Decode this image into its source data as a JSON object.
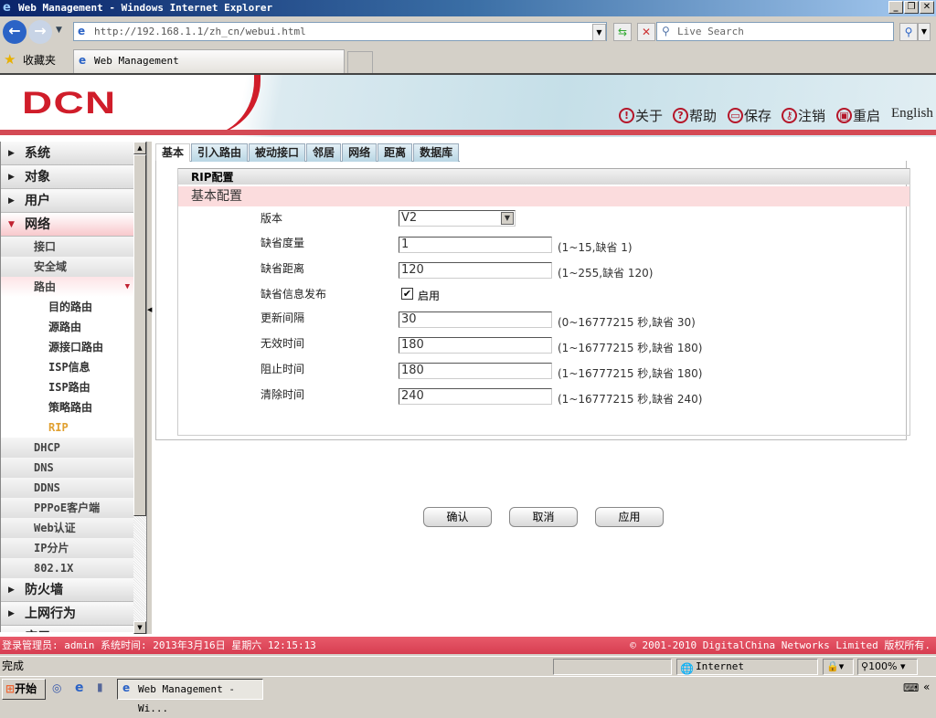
{
  "window": {
    "title": "Web Management - Windows Internet Explorer"
  },
  "browser": {
    "url": "http://192.168.1.1/zh_cn/webui.html",
    "search_placeholder": "Live Search",
    "favorites": "收藏夹",
    "tab_title": "Web Management"
  },
  "header": {
    "logo": "DCN",
    "links": [
      {
        "label": "关于",
        "icon": "info-icon"
      },
      {
        "label": "帮助",
        "icon": "help-icon"
      },
      {
        "label": "保存",
        "icon": "save-icon"
      },
      {
        "label": "注销",
        "icon": "key-icon"
      },
      {
        "label": "重启",
        "icon": "restart-icon"
      }
    ],
    "english": "English"
  },
  "sidebar": {
    "items": [
      {
        "label": "系统",
        "level": 1
      },
      {
        "label": "对象",
        "level": 1
      },
      {
        "label": "用户",
        "level": 1
      },
      {
        "label": "网络",
        "level": 1,
        "open": true
      },
      {
        "label": "接口",
        "level": 2
      },
      {
        "label": "安全域",
        "level": 2
      },
      {
        "label": "路由",
        "level": 2,
        "open": true
      },
      {
        "label": "目的路由",
        "level": 3
      },
      {
        "label": "源路由",
        "level": 3
      },
      {
        "label": "源接口路由",
        "level": 3
      },
      {
        "label": "ISP信息",
        "level": 3
      },
      {
        "label": "ISP路由",
        "level": 3
      },
      {
        "label": "策略路由",
        "level": 3
      },
      {
        "label": "RIP",
        "level": 3,
        "active": true
      },
      {
        "label": "DHCP",
        "level": 2
      },
      {
        "label": "DNS",
        "level": 2
      },
      {
        "label": "DDNS",
        "level": 2
      },
      {
        "label": "PPPoE客户端",
        "level": 2
      },
      {
        "label": "Web认证",
        "level": 2
      },
      {
        "label": "IP分片",
        "level": 2
      },
      {
        "label": "802.1X",
        "level": 2
      },
      {
        "label": "防火墙",
        "level": 1
      },
      {
        "label": "上网行为",
        "level": 1
      },
      {
        "label": "应用",
        "level": 1
      }
    ]
  },
  "tabs": [
    "基本",
    "引入路由",
    "被动接口",
    "邻居",
    "网络",
    "距离",
    "数据库"
  ],
  "active_tab": "基本",
  "panel": {
    "title": "RIP配置",
    "section": "基本配置",
    "version": {
      "label": "版本",
      "value": "V2"
    },
    "fields": [
      {
        "label": "缺省度量",
        "value": "1",
        "hint": "(1~15,缺省 1)"
      },
      {
        "label": "缺省距离",
        "value": "120",
        "hint": "(1~255,缺省 120)"
      }
    ],
    "default_info": {
      "label": "缺省信息发布",
      "checkbox_label": "启用",
      "checked": true
    },
    "timers": [
      {
        "label": "更新间隔",
        "value": "30",
        "hint": "(0~16777215 秒,缺省 30)"
      },
      {
        "label": "无效时间",
        "value": "180",
        "hint": "(1~16777215 秒,缺省 180)"
      },
      {
        "label": "阻止时间",
        "value": "180",
        "hint": "(1~16777215 秒,缺省 180)"
      },
      {
        "label": "清除时间",
        "value": "240",
        "hint": "(1~16777215 秒,缺省 240)"
      }
    ],
    "buttons": {
      "ok": "确认",
      "cancel": "取消",
      "apply": "应用"
    }
  },
  "footer": {
    "left": "登录管理员: admin 系统时间: 2013年3月16日 星期六 12:15:13",
    "right": "© 2001-2010 DigitalChina Networks Limited 版权所有."
  },
  "status": {
    "text": "完成",
    "zone": "Internet",
    "zoom": "100%"
  },
  "taskbar": {
    "start": "开始",
    "task": "Web Management - Wi..."
  },
  "colors": {
    "brand_red": "#d01d2a",
    "footer_red": "#d63c50",
    "active_item": "#e0a030"
  }
}
